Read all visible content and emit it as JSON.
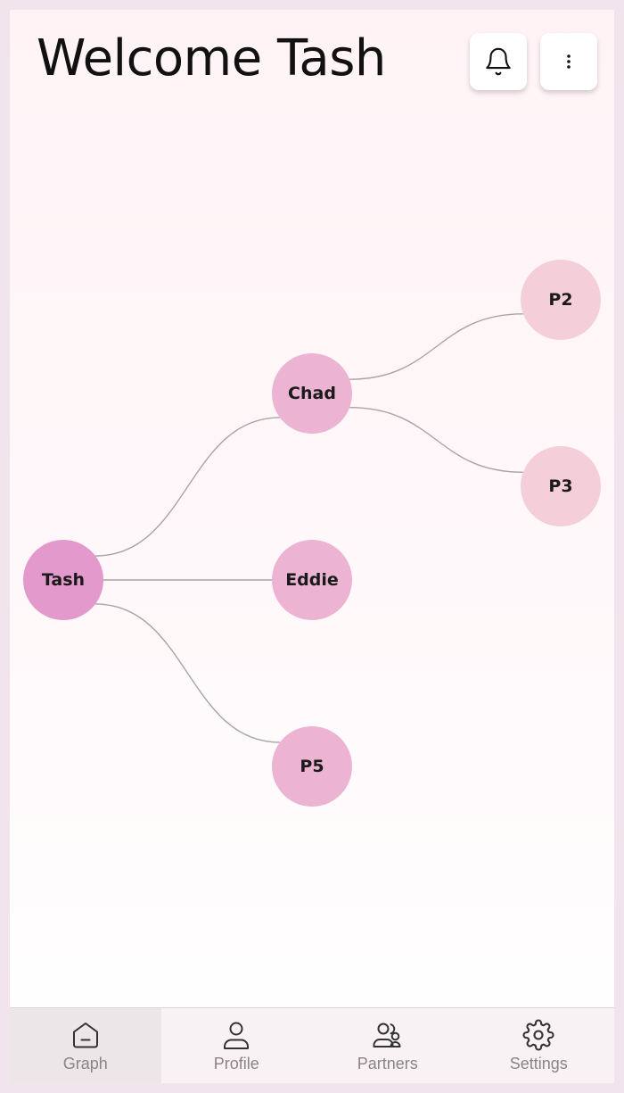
{
  "header": {
    "title": "Welcome Tash"
  },
  "actions": {
    "notifications_icon": "bell-icon",
    "more_icon": "more-vertical-icon"
  },
  "graph": {
    "root": "Tash",
    "nodes": [
      {
        "id": "tash",
        "label": "Tash",
        "color": "#e399cc"
      },
      {
        "id": "chad",
        "label": "Chad",
        "color": "#ecb3d3"
      },
      {
        "id": "eddie",
        "label": "Eddie",
        "color": "#ecb3d3"
      },
      {
        "id": "p5",
        "label": "P5",
        "color": "#ecb3d3"
      },
      {
        "id": "p2",
        "label": "P2",
        "color": "#f4cfd9"
      },
      {
        "id": "p3",
        "label": "P3",
        "color": "#f4cfd9"
      }
    ],
    "edges": [
      [
        "tash",
        "chad"
      ],
      [
        "tash",
        "eddie"
      ],
      [
        "tash",
        "p5"
      ],
      [
        "chad",
        "p2"
      ],
      [
        "chad",
        "p3"
      ]
    ],
    "edge_color": "#a8a4a8"
  },
  "navbar": {
    "items": [
      {
        "label": "Graph",
        "icon": "home-icon",
        "active": true
      },
      {
        "label": "Profile",
        "icon": "user-icon",
        "active": false
      },
      {
        "label": "Partners",
        "icon": "users-icon",
        "active": false
      },
      {
        "label": "Settings",
        "icon": "gear-icon",
        "active": false
      }
    ]
  }
}
